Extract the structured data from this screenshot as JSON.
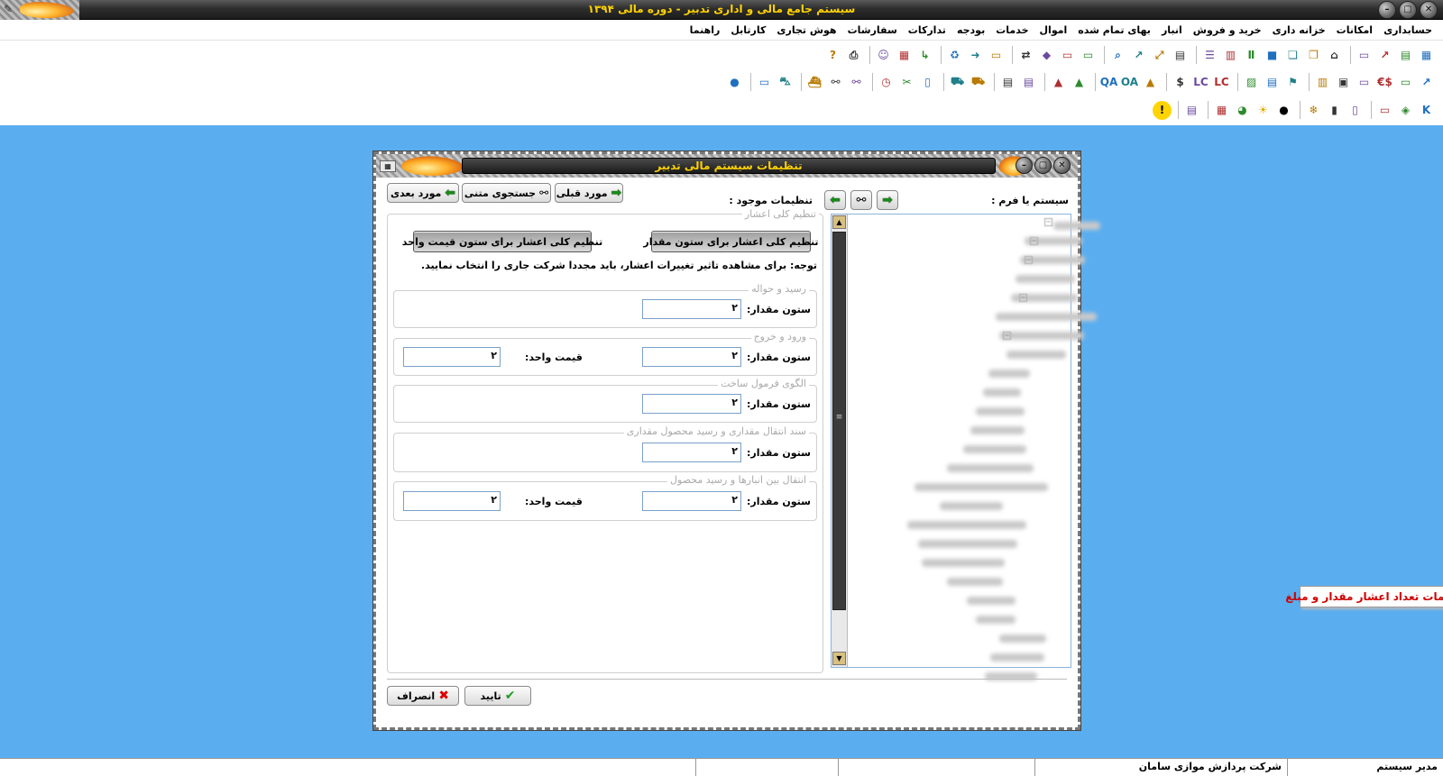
{
  "window": {
    "title": "سیستم جامع مالی و اداری تدبیر - دوره مالی ۱۳۹۴"
  },
  "menu": [
    "حسابداری",
    "امکانات",
    "خزانه داری",
    "خرید و فروش",
    "انبار",
    "بهای تمام شده",
    "اموال",
    "خدمات",
    "بودجه",
    "تدارکات",
    "سفارشات",
    "هوش تجاری",
    "کارتابل",
    "راهنما"
  ],
  "toolbar_icons": {
    "row1": [
      "grid-icon",
      "report-icon",
      "chart-icon",
      "document-icon",
      "stamp-icon",
      "layers-icon",
      "cards-icon",
      "cubes-icon",
      "pillars-icon",
      "book-icon",
      "list-icon",
      "table-icon",
      "expand-icon",
      "chart2-icon",
      "search-icon",
      "document2-icon",
      "forms-icon",
      "shapes-icon",
      "workflow-icon",
      "screen-icon",
      "arrow-icon",
      "recycle-icon",
      "route-icon",
      "calendar-icon",
      "users-icon",
      "printer-icon",
      "help-icon"
    ],
    "row2": [
      "chart3-icon",
      "voucher-icon",
      "currency-icon",
      "check-icon",
      "safe-icon",
      "bank-icon",
      "flag-icon",
      "pdf-icon",
      "image-icon",
      "lc-icon",
      "lc2-icon",
      "dollar-icon",
      "cone-icon",
      "oa-icon",
      "qa-icon",
      "triangle-icon",
      "triangle2-icon",
      "ledger-icon",
      "ledger2-icon",
      "truck-icon",
      "truck2-icon",
      "book2-icon",
      "scissors-icon",
      "clock-icon",
      "binoculars-icon",
      "binoculars2-icon",
      "ship-icon",
      "vehicle-icon",
      "card-icon",
      "globe-icon"
    ],
    "row3": [
      "k-icon",
      "tag-icon",
      "box-icon",
      "document3-icon",
      "bar-chart-icon",
      "snowflake-icon",
      "moon-icon",
      "sun-icon",
      "palette-icon",
      "calculator-icon",
      "panel-icon",
      "warning-icon"
    ]
  },
  "dialog": {
    "title": "تنظیمات سیستم مالی تدبیر",
    "system_label": "سیستم یا فرم :",
    "existing_label": "تنظیمات موجود :",
    "next_button": "مورد بعدی",
    "text_search_button": "جستجوی متنی",
    "prev_button": "مورد قبلی",
    "tree_tooltip": "تنظیمات تعداد اعشار مقدار و مبلغ",
    "decimals_group": {
      "title": "تنظیم کلی اعشار",
      "btn_quantity": "تنظیم کلی اعشار برای ستون مقدار",
      "btn_unit_price": "تنظیم کلی اعشار برای ستون قیمت واحد",
      "note": "توجه: برای مشاهده تاثیر تغییرات اعشار، باید مجددا شرکت جاری را انتخاب نمایید."
    },
    "sections": [
      {
        "title": "رسید و حواله",
        "qty_label": "ستون مقدار:",
        "qty_value": "۲"
      },
      {
        "title": "ورود و خروج",
        "qty_label": "ستون مقدار:",
        "qty_value": "۲",
        "price_label": "قیمت واحد:",
        "price_value": "۲"
      },
      {
        "title": "الگوی فرمول ساخت",
        "qty_label": "ستون مقدار:",
        "qty_value": "۲"
      },
      {
        "title": "سند انتقال مقداری و رسید محصول مقداری",
        "qty_label": "ستون مقدار:",
        "qty_value": "۲"
      },
      {
        "title": "انتقال بین انبارها و رسید محصول",
        "qty_label": "ستون مقدار:",
        "qty_value": "۲",
        "price_label": "قیمت واحد:",
        "price_value": "۲"
      }
    ],
    "ok_button": "تایید",
    "cancel_button": "انصراف"
  },
  "status": {
    "user": "مدیر سیستم",
    "company": "شرکت پردازش موازی سامان",
    "cell3": "",
    "cell4": ""
  },
  "colors": {
    "desktop": "#5aaef0",
    "title_text": "#ffd200",
    "tooltip_text": "#d00000"
  }
}
